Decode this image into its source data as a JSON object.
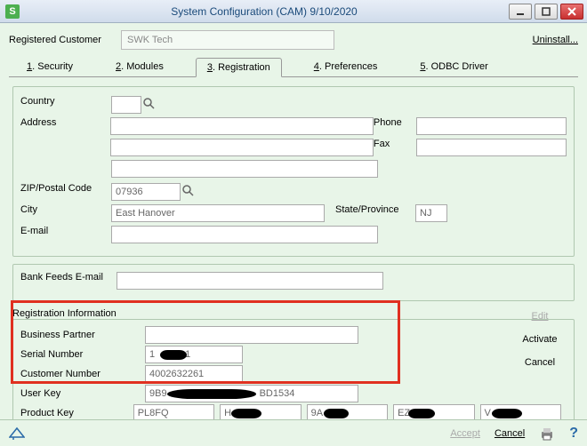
{
  "window": {
    "title": "System Configuration (CAM) 9/10/2020",
    "app_icon_letter": "S"
  },
  "header": {
    "registered_customer_label": "Registered Customer",
    "registered_customer_value": "SWK Tech",
    "uninstall": "Uninstall..."
  },
  "tabs": [
    {
      "num": "1",
      "label": "Security"
    },
    {
      "num": "2",
      "label": "Modules"
    },
    {
      "num": "3",
      "label": "Registration"
    },
    {
      "num": "4",
      "label": "Preferences"
    },
    {
      "num": "5",
      "label": "ODBC Driver"
    }
  ],
  "fields": {
    "country": "Country",
    "address": "Address",
    "phone": "Phone",
    "fax": "Fax",
    "zip_label": "ZIP/Postal Code",
    "zip_value": "07936",
    "city_label": "City",
    "city_value": "East Hanover",
    "state_label": "State/Province",
    "state_value": "NJ",
    "email": "E-mail",
    "bank_email": "Bank Feeds E-mail"
  },
  "reg": {
    "section_title": "Registration Information",
    "business_partner": "Business Partner",
    "serial_label": "Serial Number",
    "serial_prefix": "1",
    "serial_suffix": "1",
    "customer_label": "Customer Number",
    "customer_value": "4002632261",
    "userkey_label": "User Key",
    "userkey_prefix": "9B9",
    "userkey_suffix": "BD1534",
    "productkey_label": "Product Key",
    "pk": [
      "PL8FQ",
      "H",
      "9A",
      "EZ",
      "V"
    ]
  },
  "actions": {
    "edit": "Edit",
    "activate": "Activate",
    "cancel": "Cancel"
  },
  "footer": {
    "accept": "Accept",
    "cancel": "Cancel"
  }
}
